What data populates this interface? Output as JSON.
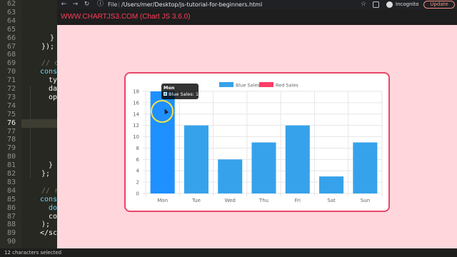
{
  "editor": {
    "line_numbers": [
      "62",
      "63",
      "64",
      "65",
      "66",
      "67",
      "68",
      "69",
      "70",
      "71",
      "72",
      "73",
      "74",
      "75",
      "76",
      "77",
      "78",
      "79",
      "80",
      "81",
      "82",
      "83",
      "84",
      "85",
      "86",
      "87",
      "88",
      "89",
      "90"
    ],
    "code_lines": [
      {
        "text": "}",
        "style": "code"
      },
      {
        "text": "});",
        "style": "code"
      },
      {
        "text": "// c",
        "style": "gray"
      },
      {
        "text": "const",
        "style": "blue"
      },
      {
        "text": "ty",
        "style": "code"
      },
      {
        "text": "da",
        "style": "code"
      },
      {
        "text": "op",
        "style": "code"
      },
      {
        "text": "}",
        "style": "code"
      },
      {
        "text": "};",
        "style": "code"
      },
      {
        "text": "// r",
        "style": "gray"
      },
      {
        "text": "cons",
        "style": "blue"
      },
      {
        "text": "do",
        "style": "blue"
      },
      {
        "text": "co",
        "style": "code"
      },
      {
        "text": ");",
        "style": "code"
      },
      {
        "text": "</sc",
        "style": "code"
      }
    ],
    "status": "12 characters selected"
  },
  "browser": {
    "nav": {
      "back": "←",
      "forward": "→",
      "reload": "↻"
    },
    "file_label": "File",
    "url": "/Users/mer/Desktop/js-tutorial-for-beginners.html",
    "star": "☆",
    "incognito_label": "Incognito",
    "update_label": "Update",
    "menu": "⋮"
  },
  "page": {
    "title": "WWW.CHARTJS3.COM (Chart JS 3.6.0)"
  },
  "tooltip": {
    "title": "Mon",
    "text": "Blue Sales: 18"
  },
  "chart_data": {
    "type": "bar",
    "categories": [
      "Mon",
      "Tue",
      "Wed",
      "Thu",
      "Fri",
      "Sat",
      "Sun"
    ],
    "series": [
      {
        "name": "Blue Sales",
        "values": [
          18,
          12,
          6,
          9,
          12,
          3,
          9
        ],
        "color": "#36a2eb",
        "hover_color": "#1e90ff"
      },
      {
        "name": "Red Sales",
        "values": [],
        "color": "#ff3d67"
      }
    ],
    "y_ticks": [
      "0",
      "2",
      "4",
      "6",
      "8",
      "10",
      "12",
      "14",
      "16",
      "18"
    ],
    "ylim": [
      0,
      18
    ],
    "grid": true,
    "legend": "top-center",
    "hovered_index": 0
  }
}
